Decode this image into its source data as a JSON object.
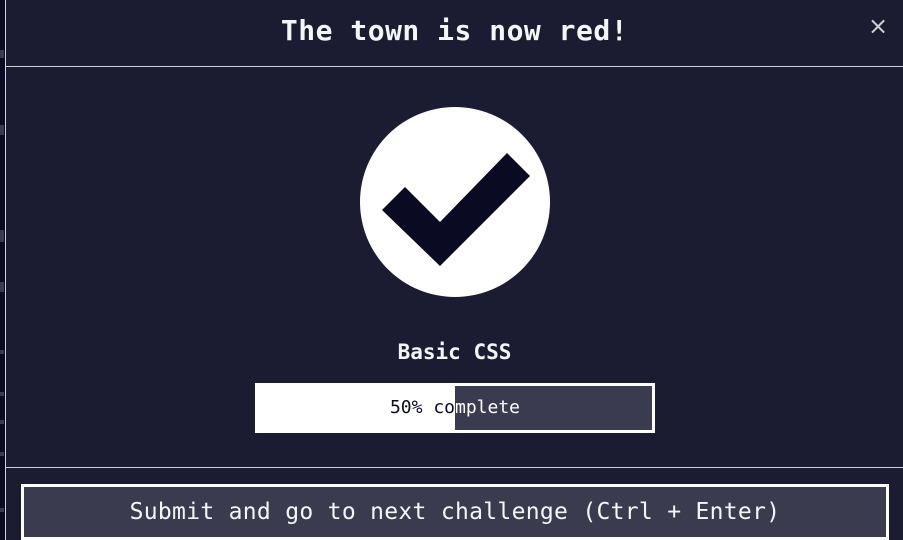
{
  "modal": {
    "title": "The town is now red!",
    "close_label": "×",
    "certification_title": "Basic CSS",
    "progress": {
      "percent": 50,
      "label_prefix": "50% co",
      "label_suffix": "mplete"
    },
    "submit_label": "Submit and go to next challenge (Ctrl + Enter)"
  },
  "icons": {
    "success": "checkmark-icon",
    "close": "close-icon"
  },
  "colors": {
    "background": "#1b1b32",
    "checkmark": "#0a0a23",
    "circle": "#ffffff",
    "button": "#3b3b4f"
  }
}
